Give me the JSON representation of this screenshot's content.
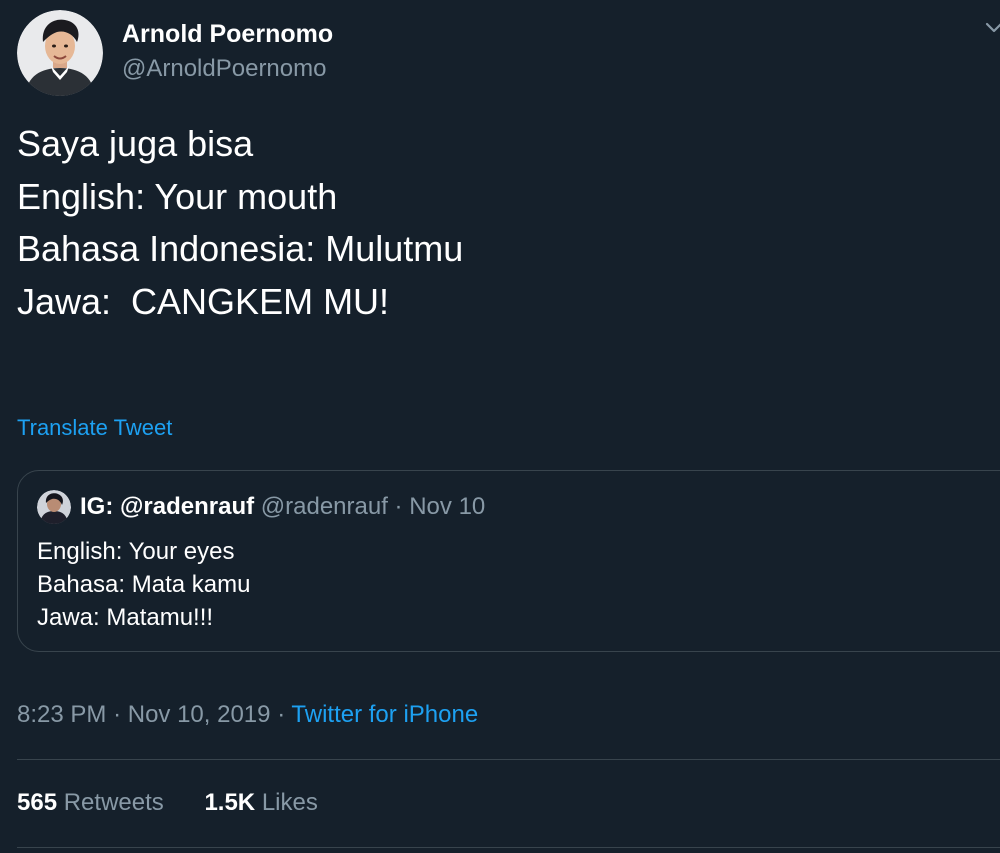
{
  "author": {
    "name": "Arnold Poernomo",
    "handle": "@ArnoldPoernomo",
    "avatar_icon": "profile-photo"
  },
  "tweet": {
    "lines": [
      "Saya juga bisa",
      "",
      "English: Your mouth",
      "Bahasa Indonesia: Mulutmu",
      "Jawa:  CANGKEM MU!"
    ],
    "translate_label": "Translate Tweet"
  },
  "quoted_tweet": {
    "name": "IG: @radenrauf",
    "handle": "@radenrauf",
    "separator": "·",
    "date": "Nov 10",
    "lines": [
      "English: Your eyes",
      "Bahasa: Mata kamu",
      "Jawa: Matamu!!!"
    ]
  },
  "meta": {
    "time": "8:23 PM",
    "separator": "·",
    "date": "Nov 10, 2019",
    "source": "Twitter for iPhone"
  },
  "stats": {
    "retweets_count": "565",
    "retweets_label": "Retweets",
    "likes_count": "1.5K",
    "likes_label": "Likes"
  },
  "colors": {
    "background": "#15202b",
    "text_primary": "#ffffff",
    "text_secondary": "#8899a6",
    "accent": "#1da1f2",
    "border": "#38444d"
  }
}
